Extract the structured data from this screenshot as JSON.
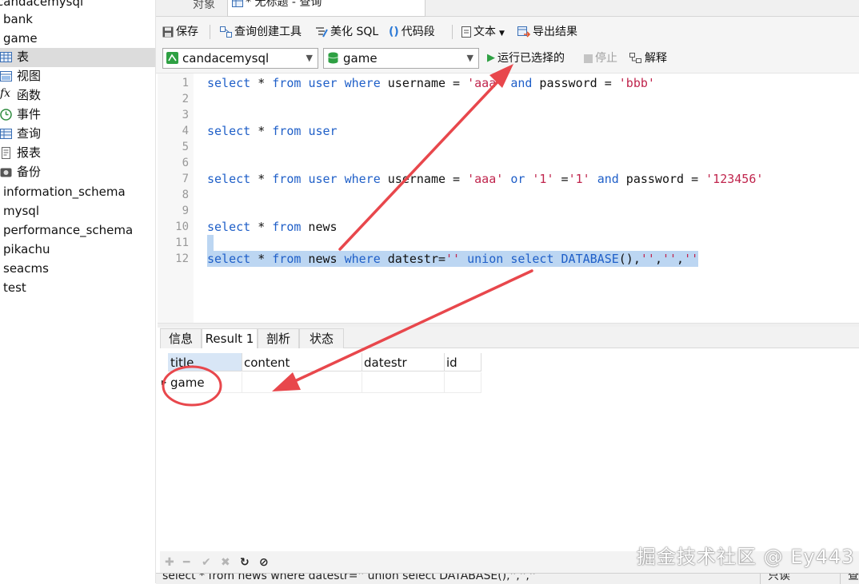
{
  "sidebar": {
    "items": [
      {
        "label": "candacemysql",
        "type": "connection"
      },
      {
        "label": "bank",
        "type": "db"
      },
      {
        "label": "game",
        "type": "db"
      },
      {
        "label": "表",
        "type": "table-node",
        "icon": "table-icon"
      },
      {
        "label": "视图",
        "type": "node",
        "icon": "view-icon"
      },
      {
        "label": "函数",
        "type": "node",
        "icon": "function-icon"
      },
      {
        "label": "事件",
        "type": "node",
        "icon": "event-clock-icon"
      },
      {
        "label": "查询",
        "type": "node",
        "icon": "query-icon"
      },
      {
        "label": "报表",
        "type": "node",
        "icon": "report-icon"
      },
      {
        "label": "备份",
        "type": "node",
        "icon": "backup-icon"
      },
      {
        "label": "information_schema",
        "type": "db"
      },
      {
        "label": "mysql",
        "type": "db"
      },
      {
        "label": "performance_schema",
        "type": "db"
      },
      {
        "label": "pikachu",
        "type": "db"
      },
      {
        "label": "seacms",
        "type": "db"
      },
      {
        "label": "test",
        "type": "db"
      }
    ]
  },
  "tabs": {
    "objects": "对象",
    "query": "* 无标题 - 查询"
  },
  "toolbar": {
    "save": "保存",
    "query_builder": "查询创建工具",
    "beautify": "美化 SQL",
    "code_snippet": "代码段",
    "text": "文本",
    "export": "导出结果"
  },
  "selectbar": {
    "connection": "candacemysql",
    "database": "game",
    "run_selected": "运行已选择的",
    "stop": "停止",
    "explain": "解释"
  },
  "editor": {
    "line_numbers": [
      "1",
      "2",
      "3",
      "4",
      "5",
      "6",
      "7",
      "8",
      "9",
      "10",
      "11",
      "12"
    ]
  },
  "result_tabs": [
    "信息",
    "Result 1",
    "剖析",
    "状态"
  ],
  "grid": {
    "columns": [
      "title",
      "content",
      "datestr",
      "id"
    ],
    "rows": [
      [
        "game",
        "",
        "",
        ""
      ]
    ]
  },
  "statusbar": {
    "sql": "select * from news where datestr='' union select DATABASE(),'','',''",
    "mode": "只读",
    "extra": "查"
  },
  "watermark": "掘金技术社区 @ Ey443",
  "colors": {
    "keyword": "#1f5fc8",
    "string": "#c0254d",
    "selection": "#bcd6f2",
    "annotation": "#e8474c"
  }
}
